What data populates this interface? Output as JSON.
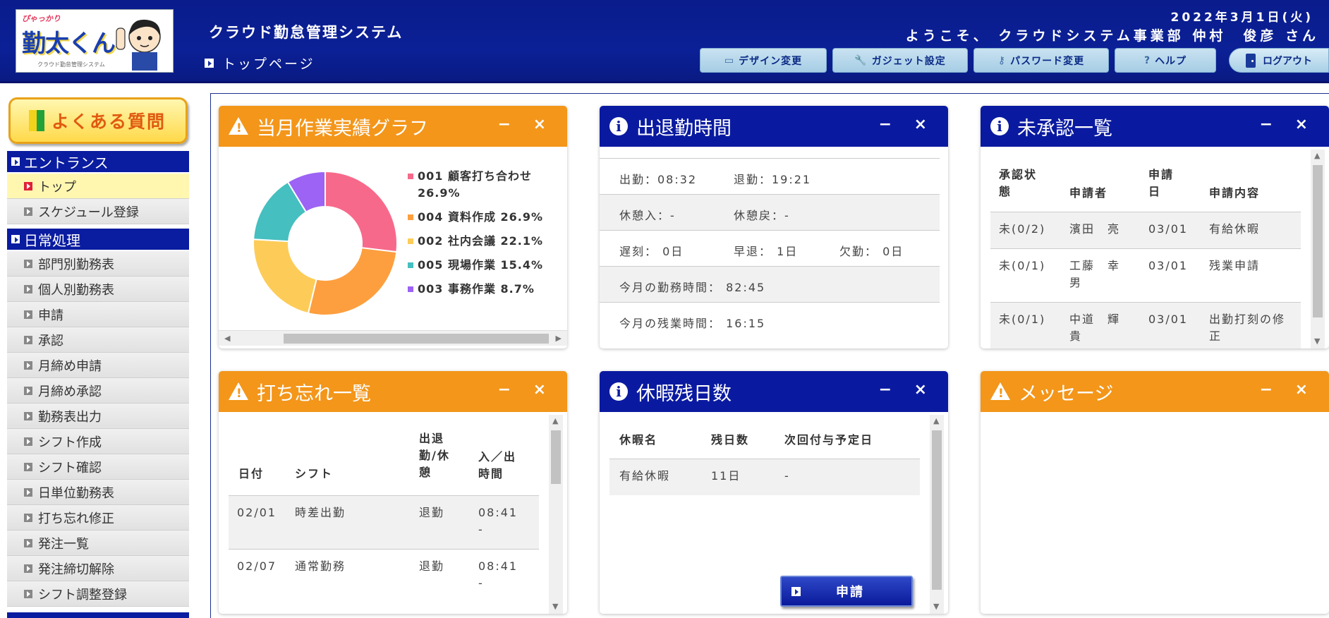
{
  "header": {
    "logo_sub": "ぴゃっかり",
    "logo_main": "勤太くん",
    "logo_caption": "クラウド勤怠管理システム",
    "system_title": "クラウド勤怠管理システム",
    "breadcrumb": "トップページ",
    "date": "2022年3月1日(火)",
    "welcome": "ようこそ、 クラウドシステム事業部 仲村　俊彦 さん",
    "buttons": {
      "design": "デザイン変更",
      "gadget": "ガジェット設定",
      "password": "パスワード変更",
      "help": "ヘルプ",
      "logout": "ログアウト"
    }
  },
  "sidebar": {
    "faq": "よくある質問",
    "sections": [
      {
        "title": "エントランス",
        "items": [
          "トップ",
          "スケジュール登録"
        ]
      },
      {
        "title": "日常処理",
        "items": [
          "部門別勤務表",
          "個人別勤務表",
          "申請",
          "承認",
          "月締め申請",
          "月締め承認",
          "勤務表出力",
          "シフト作成",
          "シフト確認",
          "日単位勤務表",
          "打ち忘れ修正",
          "発注一覧",
          "発注締切解除",
          "シフト調整登録"
        ]
      }
    ]
  },
  "panels": {
    "chart": {
      "title": "当月作業実績グラフ",
      "minimize": "−",
      "close": "×",
      "legend": [
        "001 顧客打ち合わせ 26.9%",
        "004 資料作成 26.9%",
        "002 社内会議 22.1%",
        "005 現場作業 15.4%",
        "003 事務作業 8.7%"
      ]
    },
    "attendance": {
      "title": "出退勤時間",
      "minimize": "−",
      "close": "×",
      "in_label": "出勤：08:32",
      "out_label": "退勤：19:21",
      "break_in": "休憩入：-",
      "break_out": "休憩戻：-",
      "late": "遅刻： 0日",
      "early": "早退： 1日",
      "absent": "欠勤： 0日",
      "work_time": "今月の勤務時間： 82:45",
      "overtime": "今月の残業時間： 16:15"
    },
    "unapproved": {
      "title": "未承認一覧",
      "minimize": "−",
      "close": "×",
      "headers": [
        "承認状態",
        "申請者",
        "申請日",
        "申請内容"
      ],
      "rows": [
        [
          "未(0/2)",
          "濱田　亮",
          "03/01",
          "有給休暇"
        ],
        [
          "未(0/1)",
          "工藤　幸男",
          "03/01",
          "残業申請"
        ],
        [
          "未(0/1)",
          "中道　輝貴",
          "03/01",
          "出勤打刻の修正"
        ]
      ]
    },
    "forgotten": {
      "title": "打ち忘れ一覧",
      "minimize": "−",
      "close": "×",
      "headers": [
        "日付",
        "シフト",
        "出退勤/休憩",
        "入／出時間"
      ],
      "rows": [
        [
          "02/01",
          "時差出勤",
          "退勤",
          "08:41 -"
        ],
        [
          "02/07",
          "通常勤務",
          "退勤",
          "08:41 -"
        ]
      ]
    },
    "leave": {
      "title": "休暇残日数",
      "minimize": "−",
      "close": "×",
      "headers": [
        "休暇名",
        "残日数",
        "次回付与予定日"
      ],
      "rows": [
        [
          "有給休暇",
          "11日",
          "-"
        ]
      ],
      "apply_button": "申請"
    },
    "message": {
      "title": "メッセージ",
      "minimize": "−",
      "close": "×"
    }
  },
  "chart_data": {
    "type": "pie",
    "categories": [
      "001 顧客打ち合わせ",
      "004 資料作成",
      "002 社内会議",
      "005 現場作業",
      "003 事務作業"
    ],
    "values": [
      26.9,
      26.9,
      22.1,
      15.4,
      8.7
    ],
    "colors": [
      "#f7698a",
      "#fd9f3f",
      "#fdcc58",
      "#45bfbf",
      "#9c63f5"
    ],
    "donut": true,
    "legend": "right"
  },
  "colors": {
    "header_blue": "#0a1c8c",
    "orange": "#f3961a",
    "panel_blue": "#0a1aa0"
  }
}
